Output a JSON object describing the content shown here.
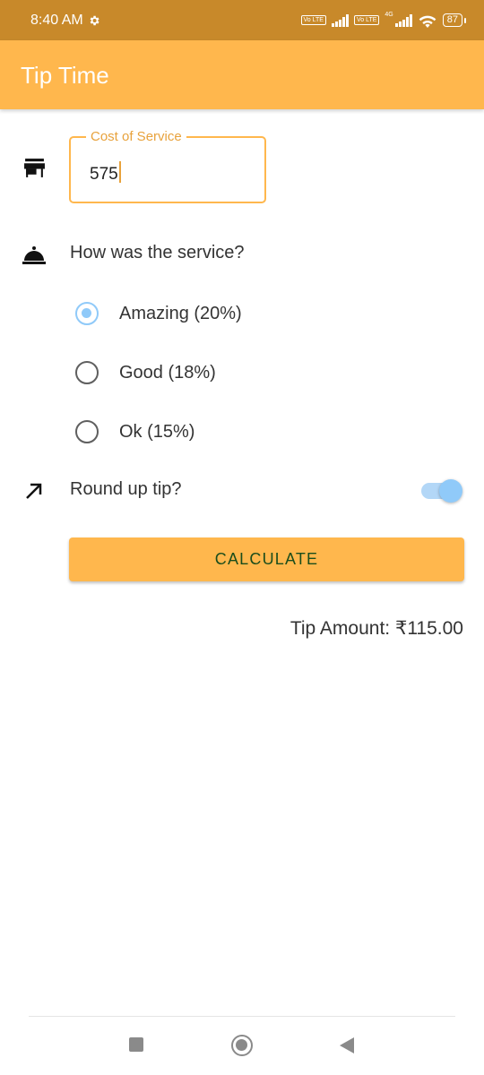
{
  "status_bar": {
    "time": "8:40 AM",
    "network_label": "4G",
    "volte_label": "Vo LTE",
    "battery": "87"
  },
  "app": {
    "title": "Tip Time"
  },
  "cost_field": {
    "label": "Cost of Service",
    "value": "575"
  },
  "service": {
    "question": "How was the service?",
    "options": [
      {
        "label": "Amazing (20%)",
        "selected": true
      },
      {
        "label": "Good (18%)",
        "selected": false
      },
      {
        "label": "Ok (15%)",
        "selected": false
      }
    ]
  },
  "round_up": {
    "label": "Round up tip?",
    "enabled": true
  },
  "calculate_button": {
    "label": "CALCULATE"
  },
  "result": {
    "tip_amount": "Tip Amount: ₹115.00"
  },
  "colors": {
    "primary": "#ffb74d",
    "status_bar": "#c8892a",
    "accent": "#90caf9",
    "button_text": "#1b4d1b"
  }
}
